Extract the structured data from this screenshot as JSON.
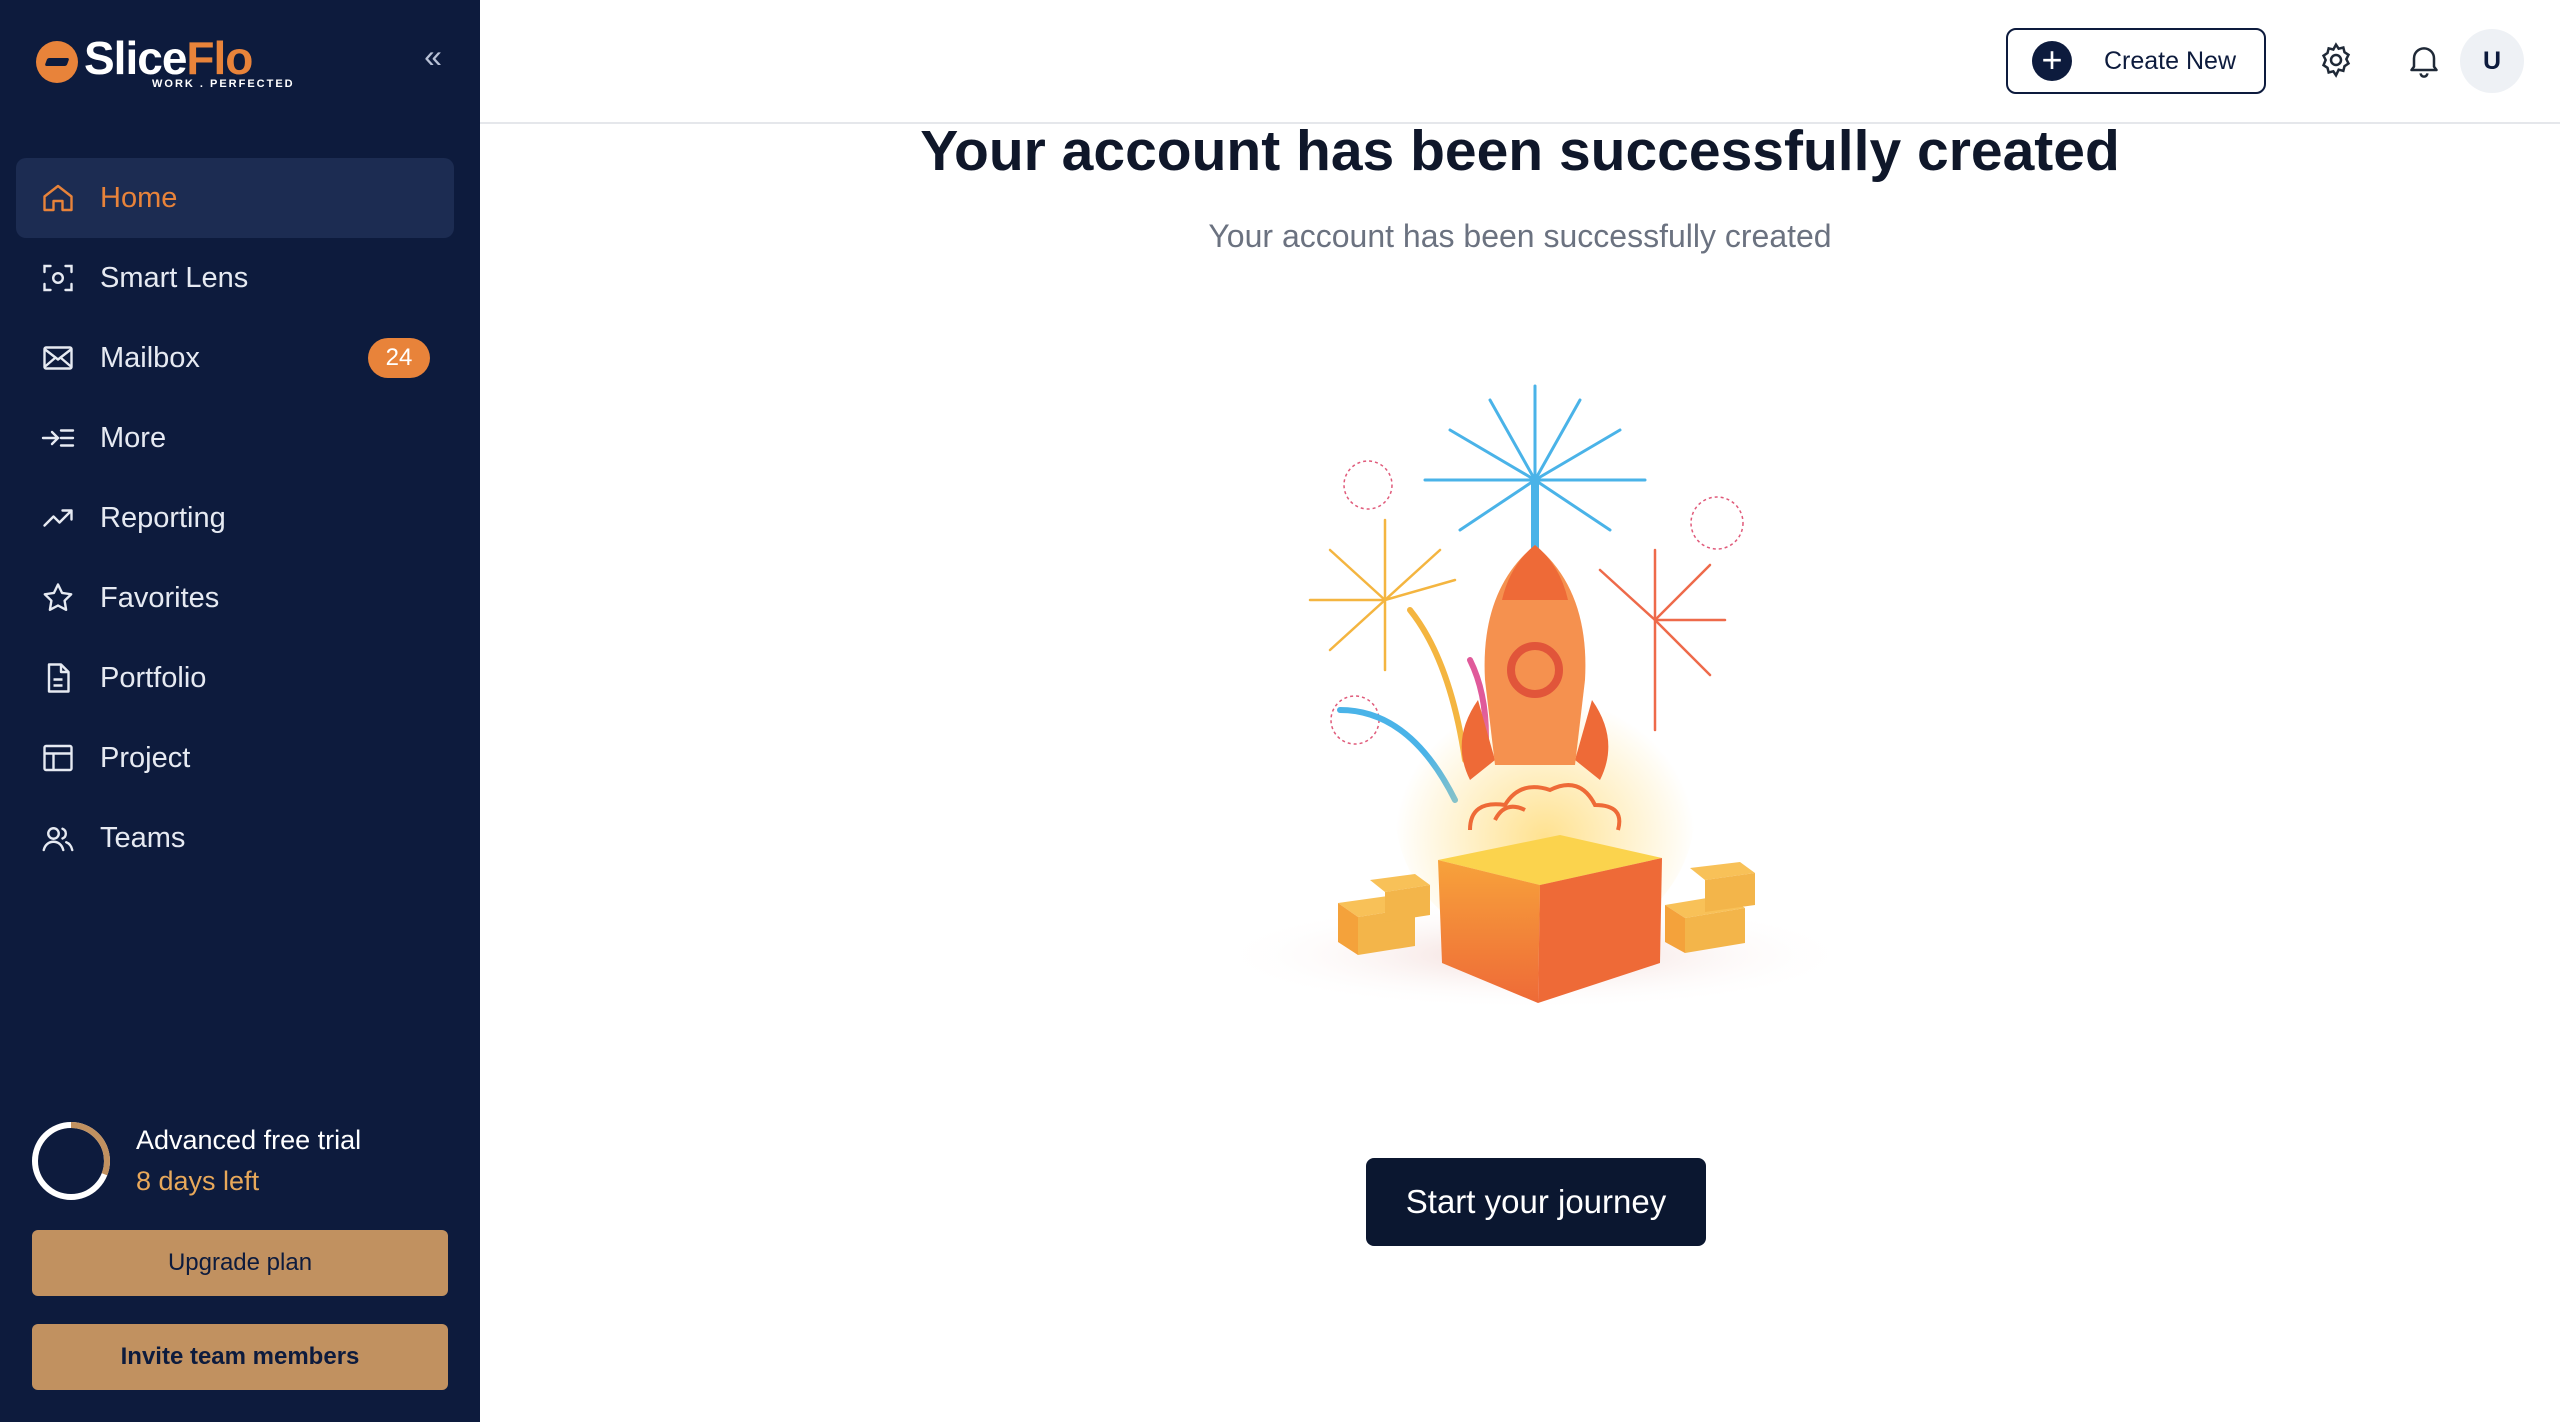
{
  "brand": {
    "name_part1": "Slice",
    "name_part2": "Flo",
    "tagline": "WORK . PERFECTED",
    "accent": "#e8833a",
    "sidebar_bg": "#0d1b3d"
  },
  "sidebar": {
    "items": [
      {
        "label": "Home",
        "icon": "home-icon",
        "active": true
      },
      {
        "label": "Smart Lens",
        "icon": "scan-icon"
      },
      {
        "label": "Mailbox",
        "icon": "mail-icon",
        "badge": "24"
      },
      {
        "label": "More",
        "icon": "more-icon"
      },
      {
        "label": "Reporting",
        "icon": "trend-icon"
      },
      {
        "label": "Favorites",
        "icon": "star-icon"
      },
      {
        "label": "Portfolio",
        "icon": "document-icon"
      },
      {
        "label": "Project",
        "icon": "layout-icon"
      },
      {
        "label": "Teams",
        "icon": "users-icon"
      }
    ],
    "trial": {
      "title": "Advanced free trial",
      "days_left": "8 days left"
    },
    "upgrade_label": "Upgrade plan",
    "invite_label": "Invite team members"
  },
  "header": {
    "create_label": "Create New",
    "avatar_initial": "U"
  },
  "main": {
    "title": "Your account has been successfully created",
    "subtitle": "Your account has been successfully created",
    "cta_label": "Start your journey"
  }
}
